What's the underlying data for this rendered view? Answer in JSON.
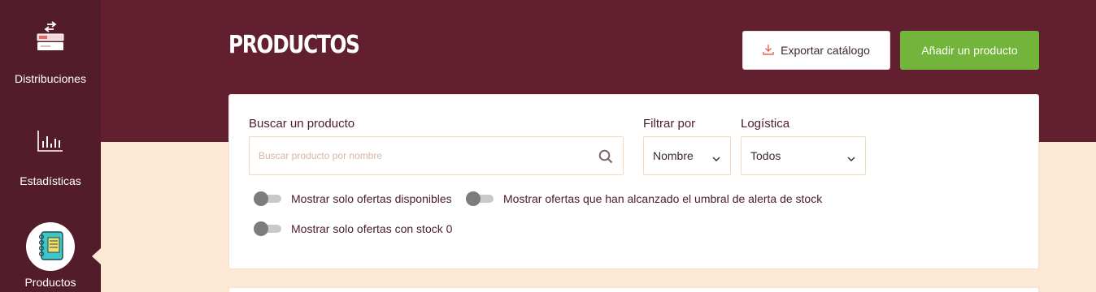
{
  "sidebar": {
    "items": [
      {
        "label": "Distribuciones",
        "icon": "boxes-icon"
      },
      {
        "label": "Estadísticas",
        "icon": "bar-chart-icon"
      },
      {
        "label": "Productos",
        "icon": "notebook-icon",
        "active": true
      }
    ]
  },
  "header": {
    "title": "PRODUCTOS",
    "export_label": "Exportar catálogo",
    "add_label": "Añadir un producto"
  },
  "filters": {
    "search_label": "Buscar un producto",
    "search_placeholder": "Buscar producto por nombre",
    "search_value": "",
    "filter_label": "Filtrar por",
    "filter_value": "Nombre",
    "logistics_label": "Logística",
    "logistics_value": "Todos"
  },
  "toggles": [
    {
      "label": "Mostrar solo ofertas disponibles",
      "on": false
    },
    {
      "label": "Mostrar ofertas que han alcanzado el umbral de alerta de stock",
      "on": false
    },
    {
      "label": "Mostrar solo ofertas con stock 0",
      "on": false
    }
  ],
  "colors": {
    "sidebar_bg": "#521c2b",
    "header_bg": "#621f2f",
    "page_bg": "#fde8d4",
    "accent_green": "#72b53a",
    "text_dark": "#4a1c28"
  }
}
